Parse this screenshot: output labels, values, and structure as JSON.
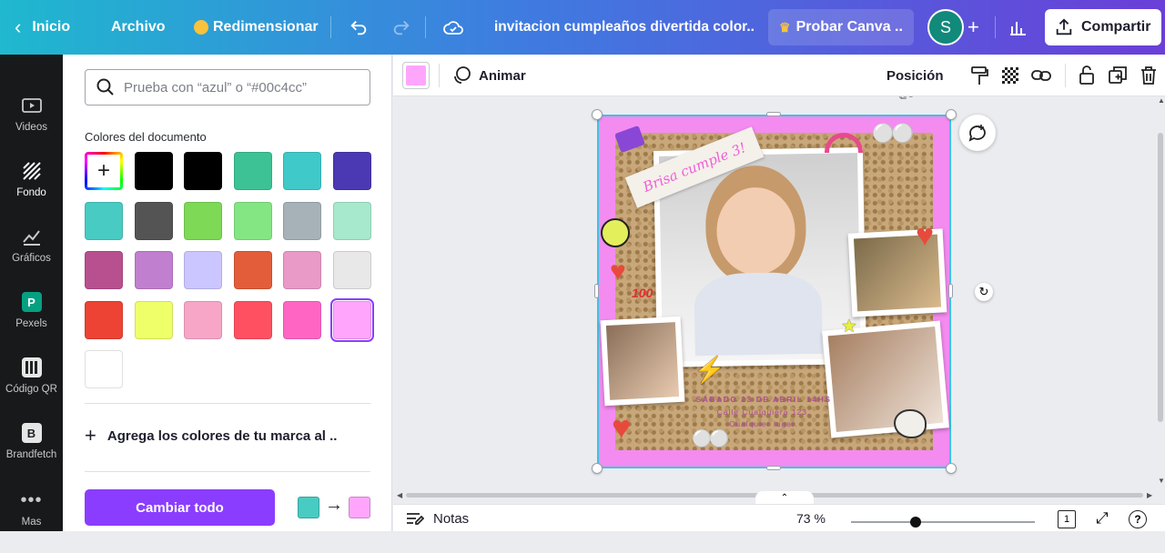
{
  "topbar": {
    "back_label": "Inicio",
    "file_label": "Archivo",
    "resize_label": "Redimensionar",
    "doc_title": "invitacion cumpleaños divertida color..",
    "try_canva_label": "Probar Canva ..",
    "avatar_letter": "S",
    "share_label": "Compartir"
  },
  "rail": {
    "items": [
      {
        "label": "Videos",
        "icon": "video-icon"
      },
      {
        "label": "Fondo",
        "icon": "background-icon"
      },
      {
        "label": "Gráficos",
        "icon": "graphics-icon"
      },
      {
        "label": "Pexels",
        "icon": "pexels-icon"
      },
      {
        "label": "Código QR",
        "icon": "qr-code-icon"
      },
      {
        "label": "Brandfetch",
        "icon": "brandfetch-icon"
      },
      {
        "label": "Mas",
        "icon": "more-icon"
      }
    ]
  },
  "panel": {
    "search_placeholder": "Prueba con “azul” o “#00c4cc”",
    "section_title": "Colores del documento",
    "swatches": [
      "#000000",
      "#000000",
      "#3cc295",
      "#3fc9c8",
      "#4b38b3",
      "#47cbc2",
      "#545454",
      "#7ed957",
      "#83e683",
      "#a6b2b8",
      "#a6e9cc",
      "#b8508f",
      "#c17fcf",
      "#cbc6ff",
      "#e35d3a",
      "#e99ac6",
      "#e8e8e8",
      "#ec4334",
      "#efff69",
      "#f7a6c7",
      "#ff5062",
      "#ff66c4",
      "#ffa6fc",
      "#ffffff"
    ],
    "selected_swatch": "#ffa6fc",
    "brand_label": "Agrega los colores de tu marca al ..",
    "change_all_label": "Cambiar todo",
    "from_color": "#47cbc2",
    "to_color": "#ffa6fc"
  },
  "toolbar": {
    "current_color": "#ffa6fc",
    "animate_label": "Animar",
    "position_label": "Posición"
  },
  "design": {
    "title_ribbon": "Brisa cumple 3!",
    "date_text": "SÁBADO 23 DE ABRIL 14HS",
    "address_line1": "Calle Cualquiera 123,",
    "address_line2": "Cualquier lugar.",
    "sticker_100": "100"
  },
  "bottombar": {
    "notes_label": "Notas",
    "zoom_level": "73 %",
    "zoom_fraction": 0.35,
    "page_number": "1"
  },
  "colors": {
    "accent": "#8b3dff",
    "selection": "#39c6e0",
    "design_bg": "#ffa6fc"
  }
}
